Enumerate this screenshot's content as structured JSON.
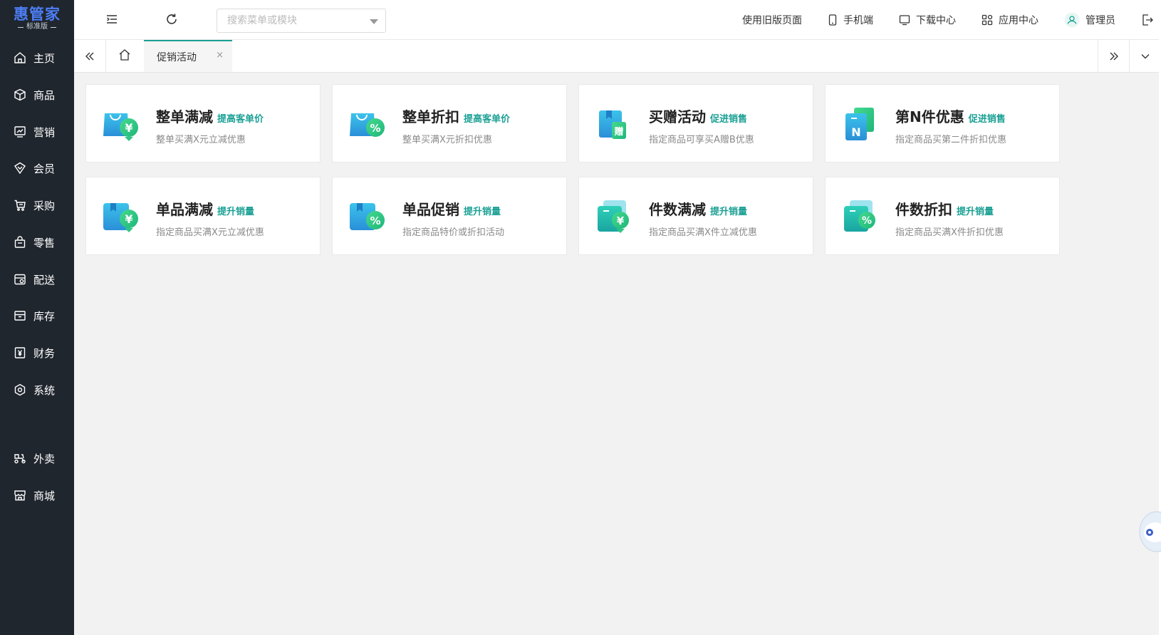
{
  "brand": {
    "name": "惠管家",
    "edition": "标准版",
    "color": "#4c7ef5"
  },
  "sidebar": {
    "items": [
      {
        "label": "主页",
        "icon": "home-icon"
      },
      {
        "label": "商品",
        "icon": "box-icon"
      },
      {
        "label": "营销",
        "icon": "chart-icon"
      },
      {
        "label": "会员",
        "icon": "gem-icon"
      },
      {
        "label": "采购",
        "icon": "cart-icon"
      },
      {
        "label": "零售",
        "icon": "bag-icon"
      },
      {
        "label": "配送",
        "icon": "delivery-icon"
      },
      {
        "label": "库存",
        "icon": "archive-icon"
      },
      {
        "label": "财务",
        "icon": "yen-icon"
      },
      {
        "label": "系统",
        "icon": "settings-icon"
      }
    ],
    "extra_items": [
      {
        "label": "外卖",
        "icon": "scooter-icon"
      },
      {
        "label": "商城",
        "icon": "store-icon"
      }
    ]
  },
  "header": {
    "search_placeholder": "搜索菜单或模块",
    "links": {
      "old_page": "使用旧版页面",
      "mobile": "手机端",
      "download": "下载中心",
      "apps": "应用中心",
      "user": "管理员"
    }
  },
  "tabs": {
    "active_label": "促销活动",
    "close_glyph": "×"
  },
  "accent_color": "#1aa094",
  "promotions": [
    {
      "title": "整单满减",
      "tag": "提高客单价",
      "desc": "整单买满X元立减优惠",
      "icon": "bag-yen-icon"
    },
    {
      "title": "整单折扣",
      "tag": "提高客单价",
      "desc": "整单买满X元折扣优惠",
      "icon": "bag-percent-icon"
    },
    {
      "title": "买赠活动",
      "tag": "促进销售",
      "desc": "指定商品可享买A赠B优惠",
      "icon": "gift-box-icon"
    },
    {
      "title": "第N件优惠",
      "tag": "促进销售",
      "desc": "指定商品买第二件折扣优惠",
      "icon": "nth-item-icon"
    },
    {
      "title": "单品满减",
      "tag": "提升销量",
      "desc": "指定商品买满X元立减优惠",
      "icon": "item-yen-icon"
    },
    {
      "title": "单品促销",
      "tag": "提升销量",
      "desc": "指定商品特价或折扣活动",
      "icon": "item-percent-icon"
    },
    {
      "title": "件数满减",
      "tag": "提升销量",
      "desc": "指定商品买满X件立减优惠",
      "icon": "qty-yen-icon"
    },
    {
      "title": "件数折扣",
      "tag": "提升销量",
      "desc": "指定商品买满X件折扣优惠",
      "icon": "qty-percent-icon"
    }
  ]
}
